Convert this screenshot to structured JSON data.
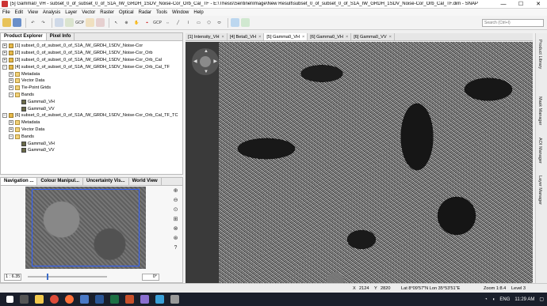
{
  "window": {
    "title": "[5] Gamma0_VH - subset_0_of_subset_0_of_S1A_IW_GRDH_1SDV_Noise-Cor_Orb_Cal_TF - E:\\Thesis\\Sentinel\\Image\\New Result\\subset_0_of_subset_0_of_S1A_IW_GRDH_1SDV_Noise-Cor_Orb_Cal_TF.dim - SNAP",
    "minimize": "—",
    "maximize": "☐",
    "close": "✕"
  },
  "menu": [
    "File",
    "Edit",
    "View",
    "Analysis",
    "Layer",
    "Vector",
    "Raster",
    "Optical",
    "Radar",
    "Tools",
    "Window",
    "Help"
  ],
  "toolbar": {
    "search_placeholder": "Search (Ctrl+I)",
    "gcp_label": "GCP",
    "pin_label": "GCP"
  },
  "left_panel": {
    "tabs": [
      "Product Explorer",
      "Pixel Info"
    ],
    "tree": [
      {
        "level": 0,
        "expander": "+",
        "icon": "prod",
        "label": "[1] subset_0_of_subset_0_of_S1A_IW_GRDH_1SDV_Noise-Cor"
      },
      {
        "level": 0,
        "expander": "+",
        "icon": "prod",
        "label": "[2] subset_0_of_subset_0_of_S1A_IW_GRDH_1SDV_Noise-Cor_Orb"
      },
      {
        "level": 0,
        "expander": "+",
        "icon": "prod",
        "label": "[3] subset_0_of_subset_0_of_S1A_IW_GRDH_1SDV_Noise-Cor_Orb_Cal"
      },
      {
        "level": 0,
        "expander": "−",
        "icon": "prod",
        "label": "[4] subset_0_of_subset_0_of_S1A_IW_GRDH_1SDV_Noise-Cor_Orb_Cal_TF"
      },
      {
        "level": 1,
        "expander": "+",
        "icon": "folder",
        "label": "Metadata"
      },
      {
        "level": 1,
        "expander": "+",
        "icon": "folder",
        "label": "Vector Data"
      },
      {
        "level": 1,
        "expander": "+",
        "icon": "folder",
        "label": "Tie-Point Grids"
      },
      {
        "level": 1,
        "expander": "−",
        "icon": "folder",
        "label": "Bands"
      },
      {
        "level": 2,
        "expander": "",
        "icon": "band",
        "label": "Gamma0_VH"
      },
      {
        "level": 2,
        "expander": "",
        "icon": "band",
        "label": "Gamma0_VV"
      },
      {
        "level": 0,
        "expander": "−",
        "icon": "prod",
        "label": "[6] subset_0_of_subset_0_of_S1A_IW_GRDH_1SDV_Noise-Cor_Orb_Cal_TF_TC"
      },
      {
        "level": 1,
        "expander": "+",
        "icon": "folder",
        "label": "Metadata"
      },
      {
        "level": 1,
        "expander": "+",
        "icon": "folder",
        "label": "Vector Data"
      },
      {
        "level": 1,
        "expander": "−",
        "icon": "folder",
        "label": "Bands"
      },
      {
        "level": 2,
        "expander": "",
        "icon": "band",
        "label": "Gamma0_VH"
      },
      {
        "level": 2,
        "expander": "",
        "icon": "band",
        "label": "Gamma0_VV"
      }
    ]
  },
  "nav_panel": {
    "tabs": [
      "Navigation ...",
      "Colour Manipul...",
      "Uncertainty Vis...",
      "World View"
    ],
    "zoom_value": "1 : 6.35",
    "angle_value": "0°",
    "slider_level": 0.24
  },
  "view_tabs": [
    {
      "label": "[1] Intensity_VH"
    },
    {
      "label": "[4] Beta0_VH"
    },
    {
      "label": "[5] Gamma0_VH",
      "active": true
    },
    {
      "label": "[6] Gamma0_VH"
    },
    {
      "label": "[6] Gamma0_VV"
    }
  ],
  "side_strip": [
    "Product Library",
    "Mask Manager",
    "AOI Manager",
    "Layer Manager"
  ],
  "status": {
    "x_label": "X",
    "x_value": "2124",
    "y_label": "Y",
    "y_value": "2820",
    "lat_lon": "Lat 8°09'57\"N  Lon 35°53'51\"E",
    "zoom": "Zoom 1:8.4",
    "level": "Level 3"
  },
  "taskbar": {
    "time": "11:29 AM",
    "lang": "ENG"
  }
}
